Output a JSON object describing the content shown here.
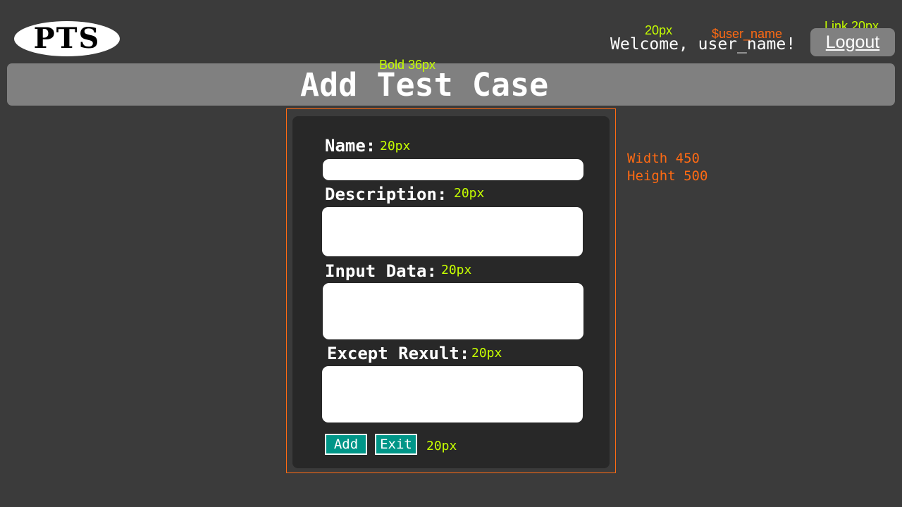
{
  "header": {
    "logo_text": "PTS",
    "welcome_text": "Welcome, user_name!",
    "logout_label": "Logout"
  },
  "title": {
    "text": "Add Test Case"
  },
  "form": {
    "fields": [
      {
        "label": "Name:",
        "value": "",
        "spec": "20px"
      },
      {
        "label": "Description:",
        "value": "",
        "spec": "20px"
      },
      {
        "label": "Input Data:",
        "value": "",
        "spec": "20px"
      },
      {
        "label": "Except Rexult:",
        "value": "",
        "spec": "20px"
      }
    ],
    "buttons": {
      "add_label": "Add",
      "exit_label": "Exit",
      "spec": "20px"
    }
  },
  "annotations": {
    "welcome_size": "20px",
    "username_variable": "$user_name",
    "logout_spec": "Link 20px",
    "title_spec": "Bold 36px",
    "form_width": "Width 450",
    "form_height": "Height 500"
  },
  "colors": {
    "background": "#3b3b3b",
    "bar": "#808080",
    "panel": "#282828",
    "button": "#009688",
    "annotation_green": "#c6ff00",
    "annotation_orange": "#ff6a13"
  }
}
